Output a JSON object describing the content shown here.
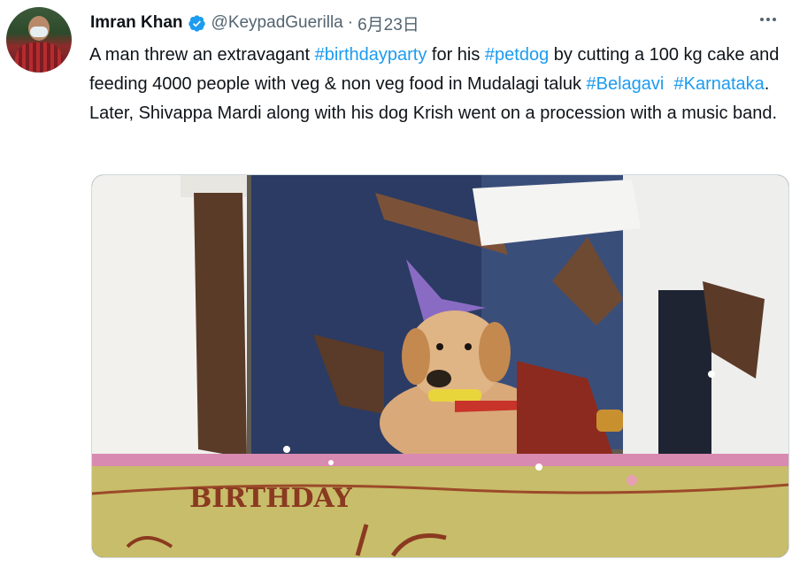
{
  "author": {
    "name": "Imran Khan",
    "handle": "@KeypadGuerilla",
    "separator": "·",
    "date": "6月23日",
    "verified_icon": "verified-badge-icon",
    "verified_color": "#1d9bf0"
  },
  "menu": {
    "icon": "more-horizontal-icon"
  },
  "tweet": {
    "segments": [
      {
        "type": "text",
        "value": "A man threw an extravagant "
      },
      {
        "type": "tag",
        "value": "#birthdayparty"
      },
      {
        "type": "text",
        "value": " for his "
      },
      {
        "type": "tag",
        "value": "#petdog"
      },
      {
        "type": "text",
        "value": " by cutting a 100 kg cake and feeding 4000 people with veg & non veg food in Mudalagi taluk "
      },
      {
        "type": "tag",
        "value": "#Belagavi"
      },
      {
        "type": "text",
        "value": "  "
      },
      {
        "type": "tag",
        "value": "#Karnataka"
      },
      {
        "type": "text",
        "value": ". Later, Shivappa Mardi along with his dog Krish went on a procession with a music band."
      }
    ]
  },
  "media": {
    "cake_text": "BIRTHDAY",
    "link_color": "#1d9bf0"
  }
}
